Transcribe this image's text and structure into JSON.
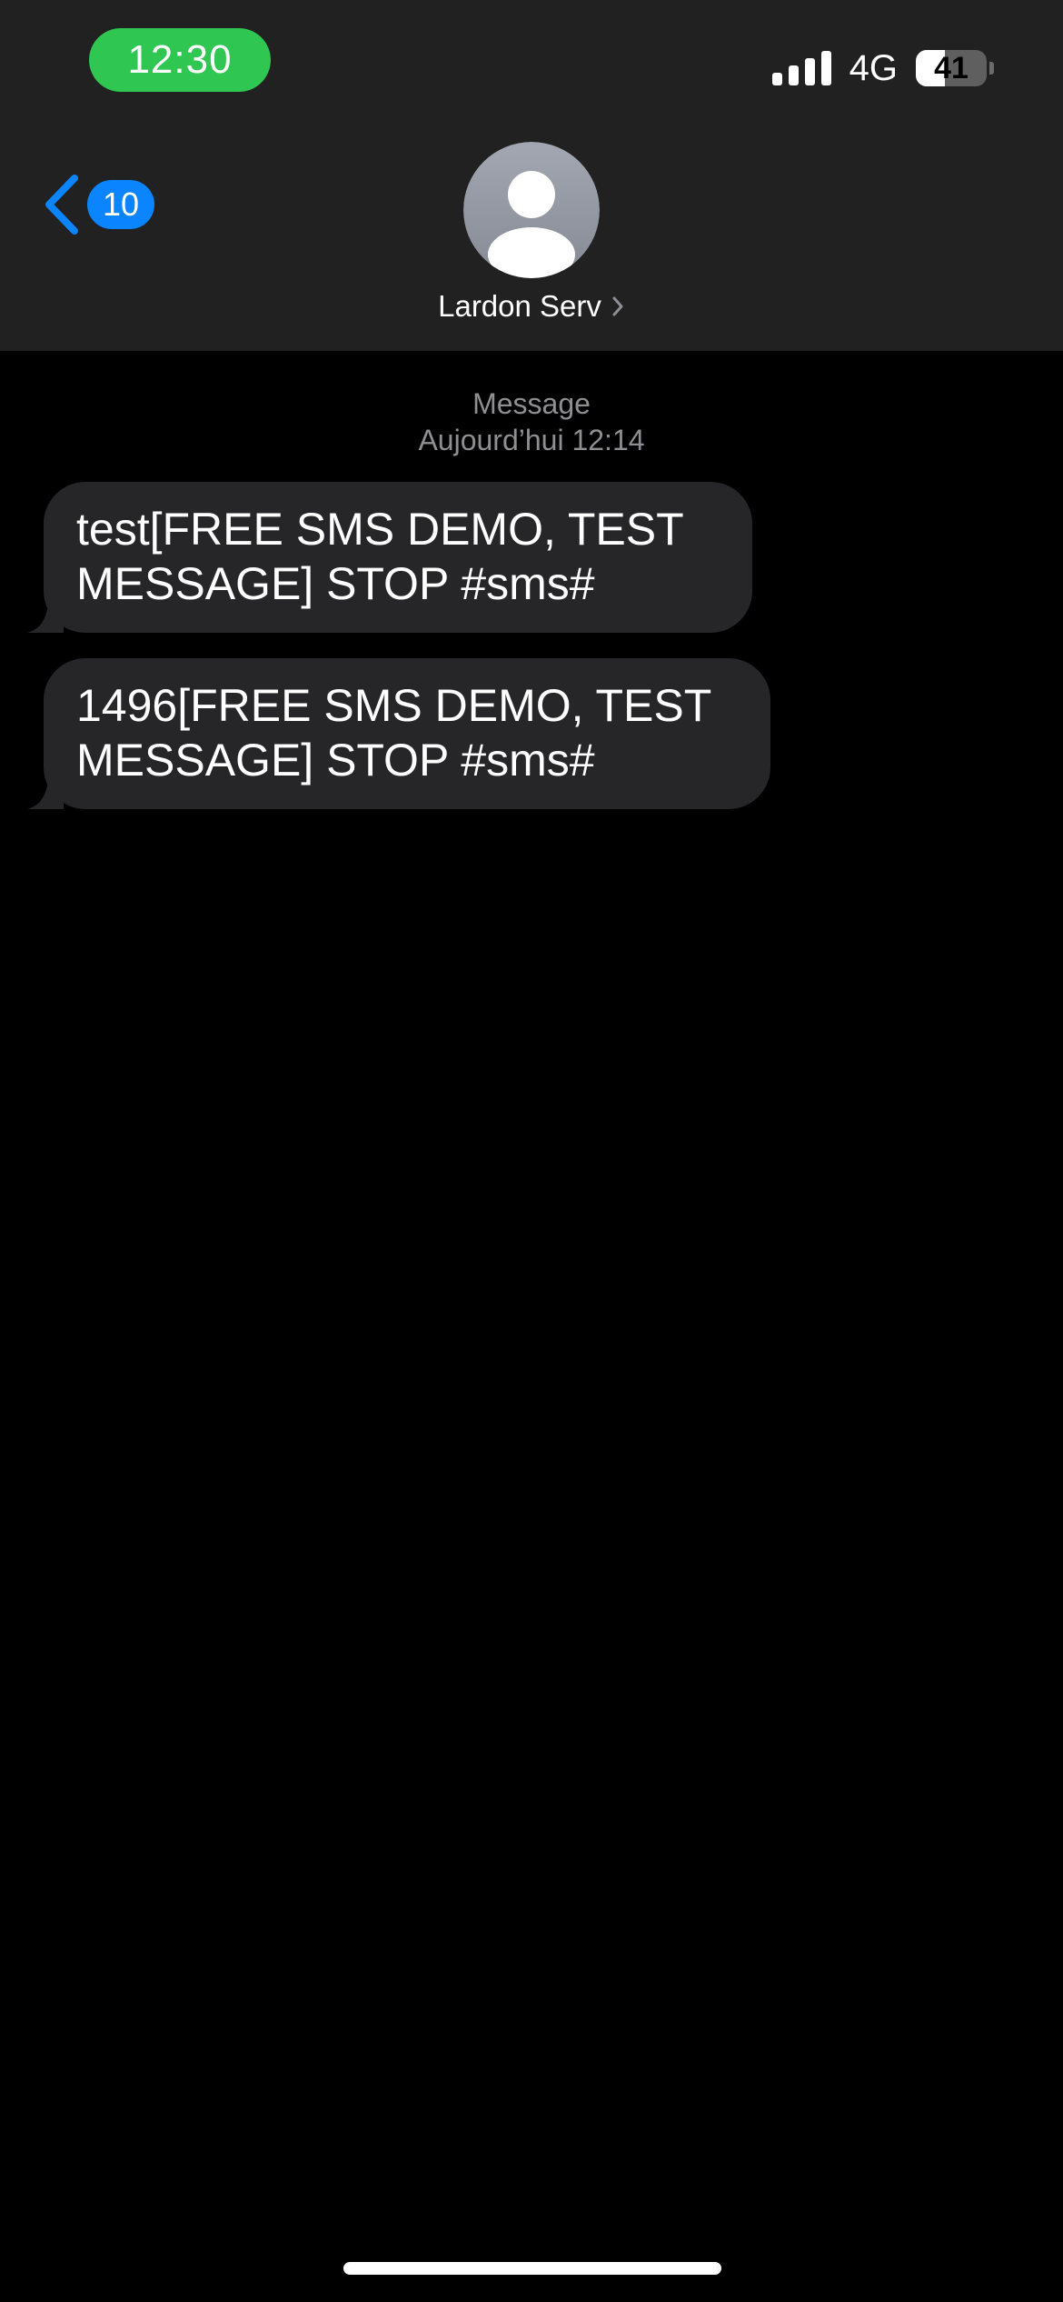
{
  "status_bar": {
    "time": "12:30",
    "network": "4G",
    "battery_level": "41",
    "battery_fraction": 0.41,
    "signal_icon": "cellular-signal-icon"
  },
  "nav": {
    "back_badge": "10",
    "contact_name": "Lardon Serv",
    "back_icon": "chevron-left-icon",
    "avatar_icon": "person-avatar-icon"
  },
  "conversation": {
    "service_label": "Message",
    "timestamp": "Aujourd’hui 12:14",
    "messages": [
      {
        "text": "test[FREE SMS DEMO, TEST MESSAGE] STOP #sms#",
        "direction": "incoming"
      },
      {
        "text": "1496[FREE SMS DEMO, TEST MESSAGE] STOP #sms#",
        "direction": "incoming"
      }
    ]
  },
  "colors": {
    "header_bg": "#212121",
    "time_pill": "#2fc652",
    "accent_blue": "#0a84ff",
    "bubble_incoming": "#262628",
    "meta_gray": "#8e8e93"
  }
}
